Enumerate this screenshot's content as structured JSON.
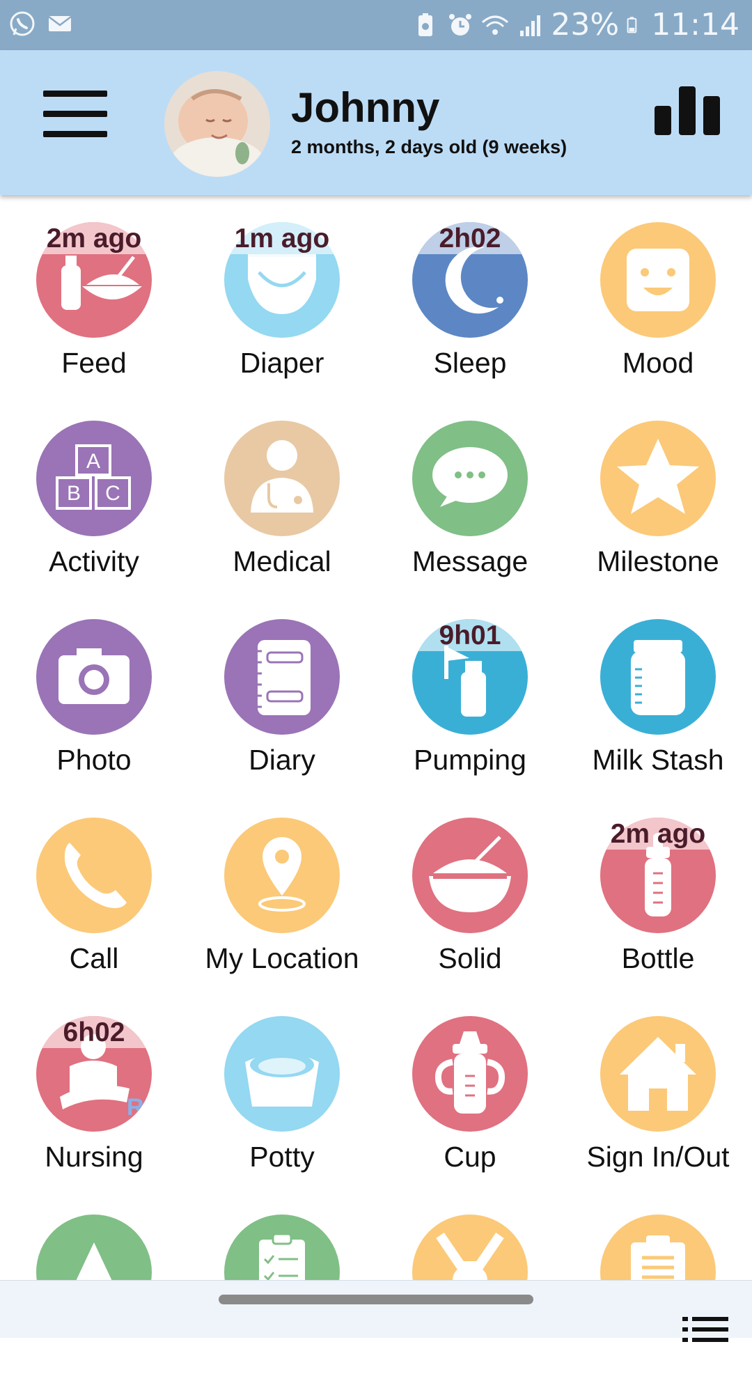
{
  "status_bar": {
    "battery": "23%",
    "time": "11:14",
    "icons_left": [
      "whatsapp-icon",
      "mail-icon"
    ],
    "icons_right": [
      "battery-saver-icon",
      "alarm-icon",
      "wifi-icon",
      "signal-icon",
      "battery-icon"
    ]
  },
  "header": {
    "child_name": "Johnny",
    "child_age": "2 months, 2 days old (9 weeks)",
    "menu_icon": "hamburger-menu-icon",
    "stats_icon": "bar-chart-icon"
  },
  "tiles": [
    {
      "id": "feed",
      "label": "Feed",
      "badge": "2m ago",
      "icon": "feed-icon",
      "color": "#e07180"
    },
    {
      "id": "diaper",
      "label": "Diaper",
      "badge": "1m ago",
      "icon": "diaper-icon",
      "color": "#94d8f1"
    },
    {
      "id": "sleep",
      "label": "Sleep",
      "badge": "2h02",
      "icon": "moon-stars-icon",
      "color": "#5c87c4"
    },
    {
      "id": "mood",
      "label": "Mood",
      "badge": "",
      "icon": "smiley-face-icon",
      "color": "#fbc978"
    },
    {
      "id": "activity",
      "label": "Activity",
      "badge": "",
      "icon": "abc-blocks-icon",
      "color": "#9a74b6"
    },
    {
      "id": "medical",
      "label": "Medical",
      "badge": "",
      "icon": "doctor-icon",
      "color": "#e8c9a4"
    },
    {
      "id": "message",
      "label": "Message",
      "badge": "",
      "icon": "chat-bubble-icon",
      "color": "#80bf86"
    },
    {
      "id": "milestone",
      "label": "Milestone",
      "badge": "",
      "icon": "star-icon",
      "color": "#fbc978"
    },
    {
      "id": "photo",
      "label": "Photo",
      "badge": "",
      "icon": "camera-icon",
      "color": "#9a74b6"
    },
    {
      "id": "diary",
      "label": "Diary",
      "badge": "",
      "icon": "notebook-icon",
      "color": "#9a74b6"
    },
    {
      "id": "pumping",
      "label": "Pumping",
      "badge": "9h01",
      "icon": "breast-pump-icon",
      "color": "#3aafd6"
    },
    {
      "id": "milkstash",
      "label": "Milk Stash",
      "badge": "",
      "icon": "milk-jar-icon",
      "color": "#3aafd6"
    },
    {
      "id": "call",
      "label": "Call",
      "badge": "",
      "icon": "phone-icon",
      "color": "#fbc978"
    },
    {
      "id": "location",
      "label": "My Location",
      "badge": "",
      "icon": "location-pin-icon",
      "color": "#fbc978"
    },
    {
      "id": "solid",
      "label": "Solid",
      "badge": "",
      "icon": "bowl-spoon-icon",
      "color": "#e07180"
    },
    {
      "id": "bottle",
      "label": "Bottle",
      "badge": "2m ago",
      "icon": "baby-bottle-icon",
      "color": "#e07180"
    },
    {
      "id": "nursing",
      "label": "Nursing",
      "badge": "6h02",
      "icon": "nursing-icon",
      "color": "#e07180",
      "side": "R"
    },
    {
      "id": "potty",
      "label": "Potty",
      "badge": "",
      "icon": "potty-icon",
      "color": "#94d8f1"
    },
    {
      "id": "cup",
      "label": "Cup",
      "badge": "",
      "icon": "sippy-cup-icon",
      "color": "#e07180"
    },
    {
      "id": "signin",
      "label": "Sign In/Out",
      "badge": "",
      "icon": "house-icon",
      "color": "#fbc978"
    },
    {
      "id": "r6a",
      "label": "",
      "badge": "",
      "icon": "tent-icon",
      "color": "#80bf86"
    },
    {
      "id": "r6b",
      "label": "",
      "badge": "",
      "icon": "checklist-icon",
      "color": "#80bf86"
    },
    {
      "id": "r6c",
      "label": "",
      "badge": "",
      "icon": "bib-icon",
      "color": "#fbc978"
    },
    {
      "id": "r6d",
      "label": "",
      "badge": "",
      "icon": "clipboard-icon",
      "color": "#fbc978"
    }
  ],
  "nav": {
    "list_icon": "list-view-icon"
  }
}
